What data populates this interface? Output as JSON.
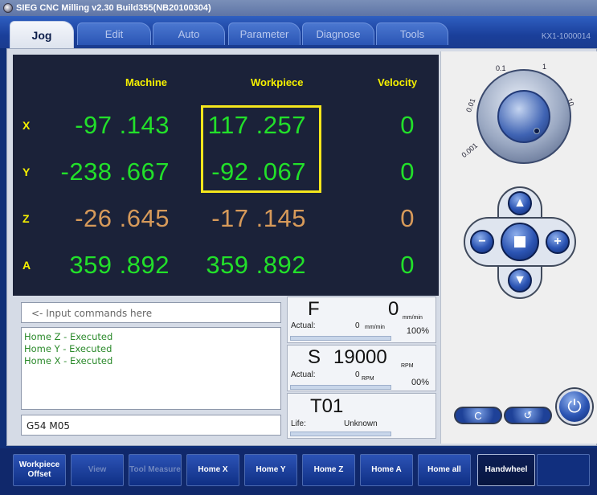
{
  "window": {
    "title": "SIEG CNC Milling v2.30 Build355(NB20100304)"
  },
  "tabs": [
    {
      "label": "Jog",
      "active": true
    },
    {
      "label": "Edit",
      "active": false
    },
    {
      "label": "Auto",
      "active": false
    },
    {
      "label": "Parameter",
      "active": false
    },
    {
      "label": "Diagnose",
      "active": false
    },
    {
      "label": "Tools",
      "active": false
    }
  ],
  "machine_id": "KX1-1000014",
  "dro": {
    "headers": {
      "machine": "Machine",
      "workpiece": "Workpiece",
      "velocity": "Velocity"
    },
    "axes": [
      {
        "name": "X",
        "machine": "-97 .143",
        "workpiece": "117 .257",
        "velocity": "0",
        "color": "#22e02a"
      },
      {
        "name": "Y",
        "machine": "-238 .667",
        "workpiece": "-92 .067",
        "velocity": "0",
        "color": "#22e02a"
      },
      {
        "name": "Z",
        "machine": "-26 .645",
        "workpiece": "-17 .145",
        "velocity": "0",
        "color": "#d79a5a"
      },
      {
        "name": "A",
        "machine": "359 .892",
        "workpiece": "359 .892",
        "velocity": "0",
        "color": "#22e02a"
      }
    ]
  },
  "command": {
    "placeholder": "<- Input commands here",
    "log": [
      "Home Z  - Executed",
      "Home Y  - Executed",
      "Home X  - Executed"
    ],
    "modal": "G54 M05"
  },
  "feed": {
    "letter": "F",
    "value": "0",
    "unit": "mm/min",
    "actual_label": "Actual:",
    "actual_value": "0",
    "actual_unit": "mm/min",
    "override": "100%"
  },
  "spindle": {
    "letter": "S",
    "value": "19000",
    "unit": "RPM",
    "actual_label": "Actual:",
    "actual_value": "0",
    "actual_unit": "RPM",
    "override": "00%"
  },
  "tool": {
    "label": "T01",
    "life_label": "Life:",
    "life_value": "Unknown"
  },
  "handwheel": {
    "scales": [
      "0.1",
      "1",
      "10",
      "0.01",
      "0.001"
    ]
  },
  "toolbar": [
    {
      "label": "Workpiece Offset",
      "state": "normal"
    },
    {
      "label": "View",
      "state": "dim"
    },
    {
      "label": "Tool Measure",
      "state": "dim"
    },
    {
      "label": "Home X",
      "state": "normal"
    },
    {
      "label": "Home Y",
      "state": "normal"
    },
    {
      "label": "Home Z",
      "state": "normal"
    },
    {
      "label": "Home A",
      "state": "normal"
    },
    {
      "label": "Home all",
      "state": "normal"
    },
    {
      "label": "Handwheel",
      "state": "active"
    },
    {
      "label": "",
      "state": "plain"
    }
  ]
}
